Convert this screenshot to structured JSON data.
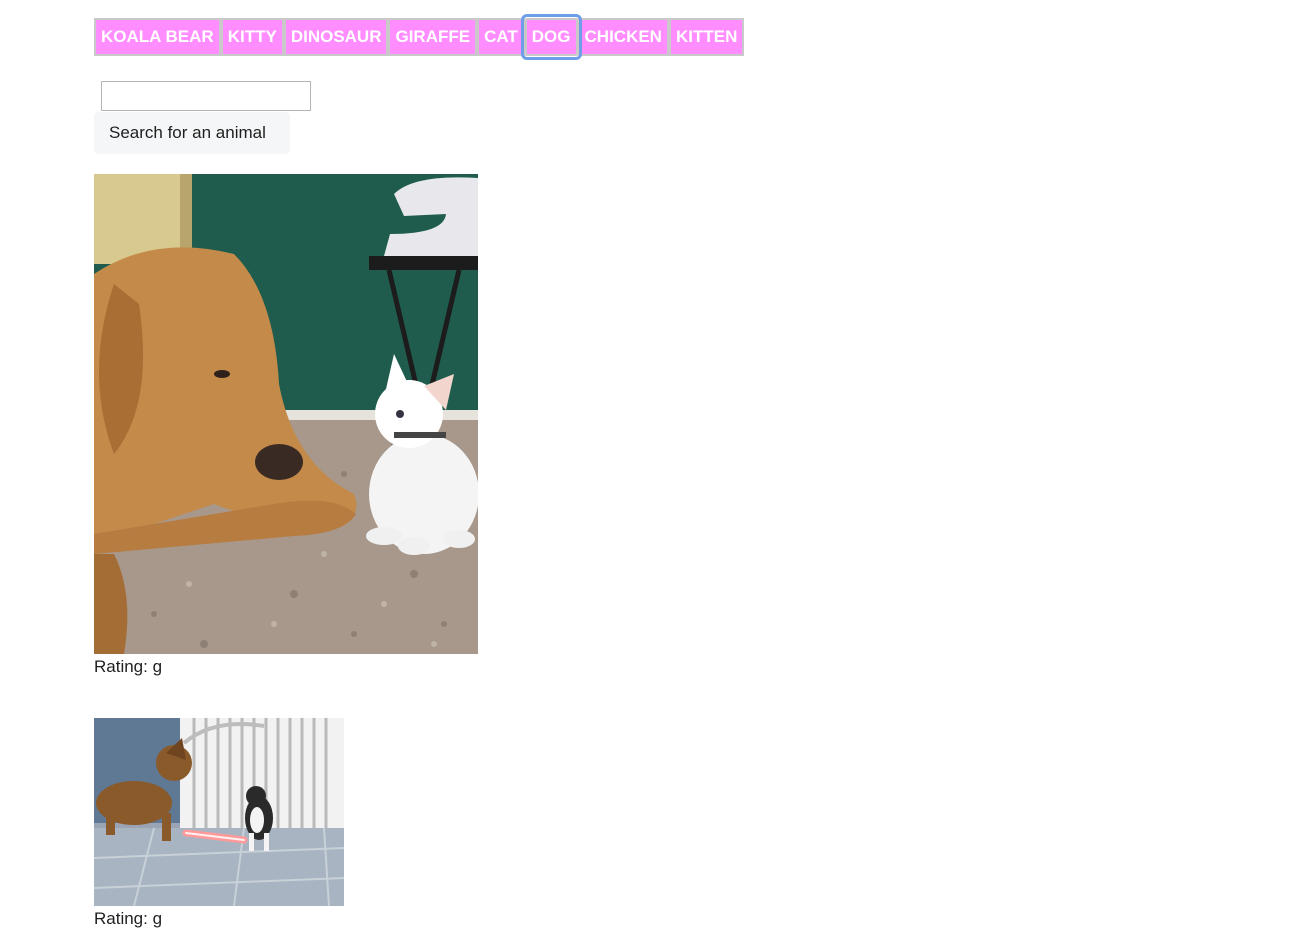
{
  "animal_buttons": [
    "KOALA BEAR",
    "KITTY",
    "DINOSAUR",
    "GIRAFFE",
    "CAT",
    "DOG",
    "CHICKEN",
    "KITTEN"
  ],
  "focused_button": "DOG",
  "search": {
    "value": "",
    "placeholder": "",
    "button_label": "Search for an animal"
  },
  "results": [
    {
      "rating_label": "Rating: g"
    },
    {
      "rating_label": "Rating: g"
    }
  ],
  "colors": {
    "button_bg": "#ff8dff",
    "button_border": "#c9c9c9",
    "button_text": "#ffffff",
    "focus_ring": "#6f9ee8"
  }
}
